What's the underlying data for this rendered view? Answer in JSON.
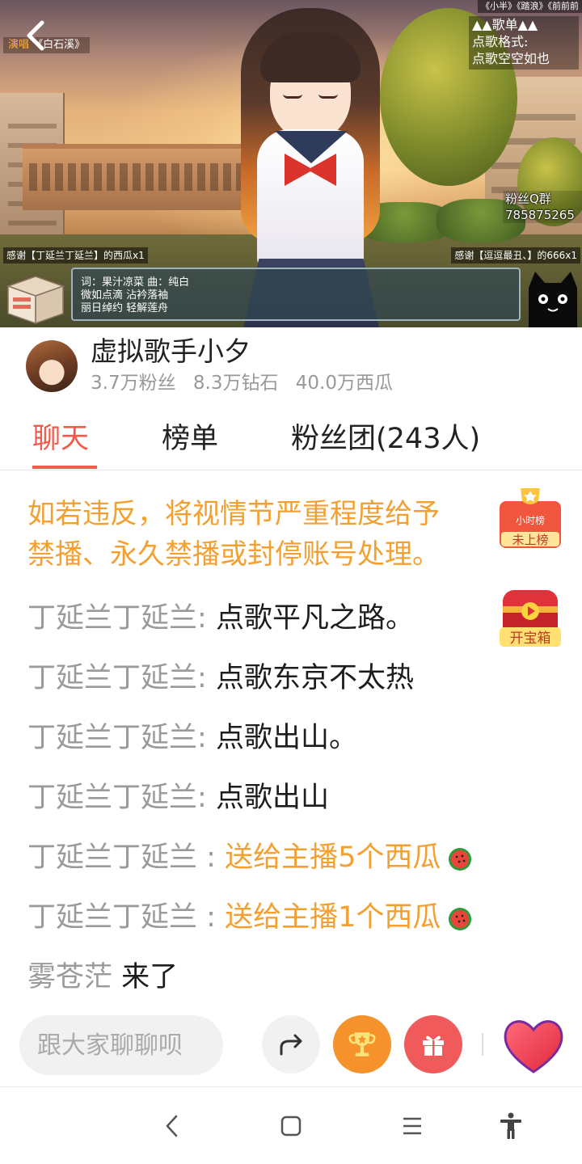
{
  "video": {
    "top_ticker": "《小半》《踏浪》《前前前",
    "singing_label": "演唱",
    "current_song": "《白石溪》",
    "songlist_lines": [
      "▲▲歌单▲▲",
      "点歌格式:",
      "点歌空空如也"
    ],
    "fan_group_label": "粉丝Q群",
    "fan_group_number": "785875265",
    "thanks_left": "感谢【丁延兰丁延兰】的西瓜x1",
    "thanks_right": "感谢【逗逗最丑、】的666x1",
    "lyrics_lines": [
      "词：果汁凉菜  曲：纯白",
      "微如点滴  沾衿落袖",
      "丽日绰约  轻解莲舟"
    ]
  },
  "profile": {
    "name": "虚拟歌手小夕",
    "fans": "3.7万粉丝",
    "diamonds": "8.3万钻石",
    "melons": "40.0万西瓜"
  },
  "tabs": {
    "chat": "聊天",
    "ranking": "榜单",
    "fan_club": "粉丝团(243人)",
    "active": "chat"
  },
  "chat": {
    "notice_lines": [
      "如若违反，将视情节严重程度给予",
      "禁播、永久禁播或封停账号处理。"
    ],
    "messages": [
      {
        "user": "丁延兰丁延兰",
        "sep": ": ",
        "text": "点歌平凡之路。"
      },
      {
        "user": "丁延兰丁延兰",
        "sep": ": ",
        "text": "点歌东京不太热"
      },
      {
        "user": "丁延兰丁延兰",
        "sep": ": ",
        "text": "点歌出山。"
      },
      {
        "user": "丁延兰丁延兰",
        "sep": ": ",
        "text": "点歌出山"
      },
      {
        "user": "丁延兰丁延兰",
        "sep": " : ",
        "gift": "送给主播5个西瓜"
      },
      {
        "user": "丁延兰丁延兰",
        "sep": " : ",
        "gift": "送给主播1个西瓜"
      },
      {
        "user": "雾苍茫",
        "sep": " ",
        "text": "来了"
      }
    ],
    "rank_badge": {
      "title": "小时榜",
      "status": "未上榜"
    },
    "treasure_label": "开宝箱"
  },
  "input": {
    "placeholder": "跟大家聊聊呗"
  },
  "colors": {
    "accent": "#f05a4a",
    "gift_text": "#f3a030",
    "username": "#9a9a9a",
    "trophy_button": "#f5922b",
    "gift_button": "#f05a5a"
  },
  "icons": [
    "back-arrow-icon",
    "box-icon",
    "cat-icon",
    "watermelon-icon",
    "trophy-icon",
    "treasure-chest-icon",
    "share-icon",
    "gift-icon",
    "heart-icon",
    "nav-back-icon",
    "nav-home-icon",
    "nav-menu-icon",
    "accessibility-icon"
  ]
}
